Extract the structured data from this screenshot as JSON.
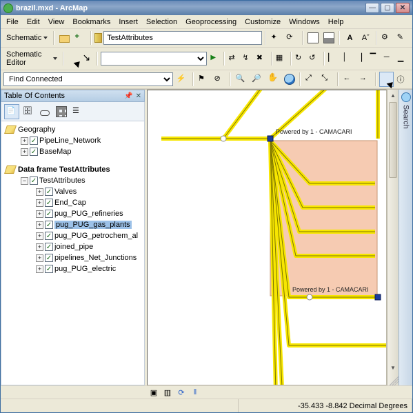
{
  "title": "brazil.mxd - ArcMap",
  "menubar": [
    "File",
    "Edit",
    "View",
    "Bookmarks",
    "Insert",
    "Selection",
    "Geoprocessing",
    "Customize",
    "Windows",
    "Help"
  ],
  "toolbar_schematic": {
    "label": "Schematic",
    "dataset": "TestAttributes"
  },
  "toolbar_editor": {
    "label": "Schematic Editor"
  },
  "find_connected": "Find Connected",
  "toc": {
    "title": "Table Of Contents",
    "group1": {
      "frame": "Geography",
      "layers": [
        "PipeLine_Network",
        "BaseMap"
      ]
    },
    "group2": {
      "frame": "Data frame TestAttributes",
      "root_layer": "TestAttributes",
      "sublayers": [
        "Valves",
        "End_Cap",
        "pug_PUG_refineries",
        "pug_PUG_gas_plants",
        "pug_PUG_petrochem_al",
        "joined_pipe",
        "pipelines_Net_Junctions",
        "pug_PUG_electric"
      ],
      "selected_index": 3
    }
  },
  "map_labels": {
    "a": "Powered by 1 - CAMACARI",
    "b": "Powered by 1 - CAMACARI"
  },
  "righttab": "Search",
  "status": {
    "coords": "-35.433  -8.842 Decimal Degrees"
  },
  "font_buttons": {
    "bold": "A",
    "smaller": "Aˇ"
  }
}
